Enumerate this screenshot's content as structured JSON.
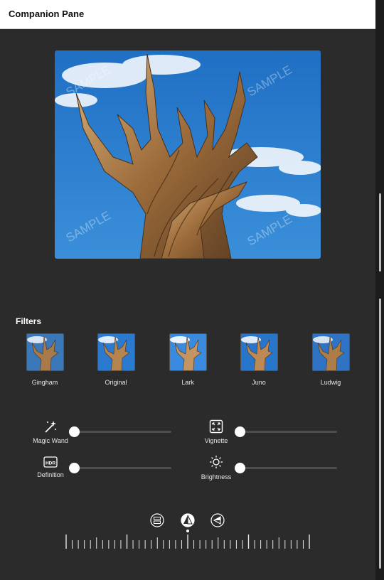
{
  "window": {
    "title": "Companion Pane"
  },
  "preview": {
    "watermark": "SAMPLE"
  },
  "filters": {
    "heading": "Filters",
    "items": [
      {
        "label": "Gingham"
      },
      {
        "label": "Original"
      },
      {
        "label": "Lark"
      },
      {
        "label": "Juno"
      },
      {
        "label": "Ludwig"
      }
    ]
  },
  "adjustments": {
    "magic_wand": {
      "label": "Magic Wand",
      "icon": "magic-wand-icon",
      "value": 0
    },
    "vignette": {
      "label": "Vignette",
      "icon": "vignette-icon",
      "value": 0
    },
    "definition": {
      "label": "Definition",
      "icon": "hdr-icon",
      "badge": "HDR",
      "value": 0
    },
    "brightness": {
      "label": "Brightness",
      "icon": "sun-icon",
      "value": 0
    }
  },
  "rotation": {
    "modes": [
      "flip-icon",
      "straighten-icon",
      "perspective-icon"
    ],
    "selected_mode": "straighten-icon"
  },
  "colors": {
    "background": "#2b2b2b",
    "sky": "#2f7fd0"
  }
}
